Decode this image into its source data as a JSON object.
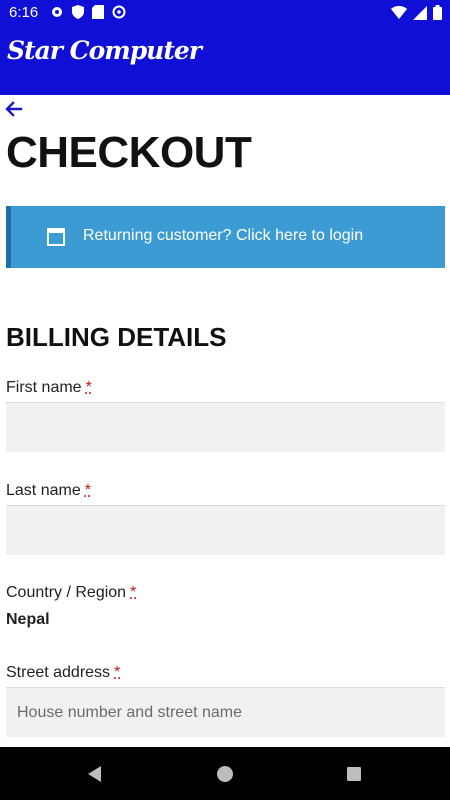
{
  "status_bar": {
    "time": "6:16"
  },
  "app_bar": {
    "brand": "Star Computer"
  },
  "page": {
    "title": "CHECKOUT"
  },
  "login_notice": {
    "text": "Returning customer? Click here to login"
  },
  "billing": {
    "section_title": "BILLING DETAILS",
    "required_marker": "*",
    "first_name": {
      "label": "First name",
      "value": "",
      "placeholder": ""
    },
    "last_name": {
      "label": "Last name",
      "value": "",
      "placeholder": ""
    },
    "country": {
      "label": "Country / Region",
      "value": "Nepal"
    },
    "street": {
      "label": "Street address",
      "value": "",
      "placeholder": "House number and street name"
    }
  },
  "colors": {
    "brand_blue": "#0f0fd6",
    "notice_blue": "#3d9bd3",
    "required_red": "#cc1818"
  }
}
